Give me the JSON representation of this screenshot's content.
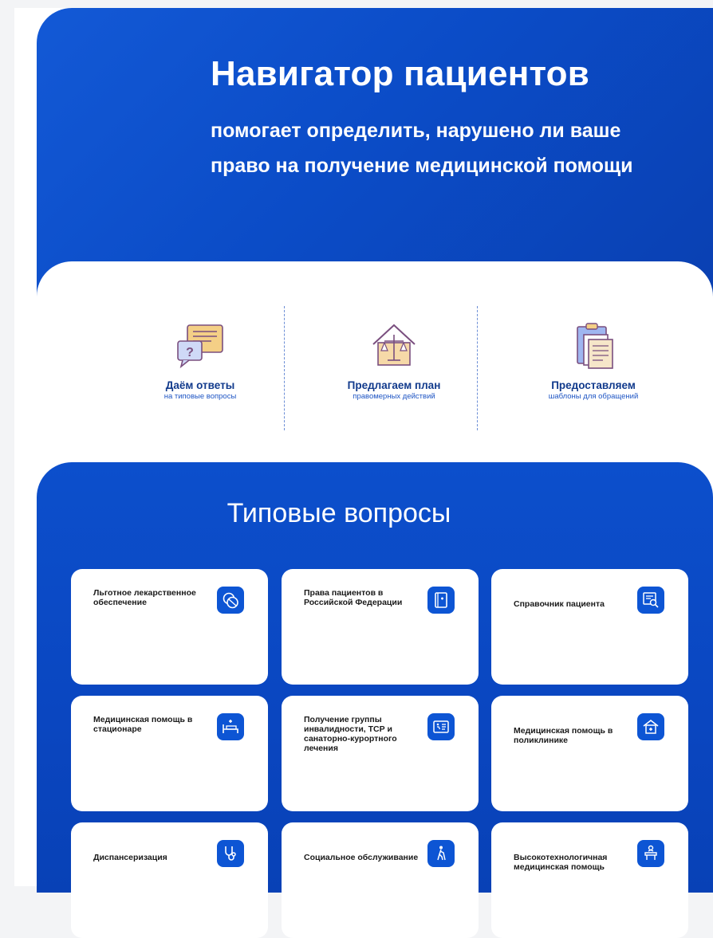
{
  "hero": {
    "title": "Навигатор пациентов",
    "subtitle": "помогает определить, нарушено ли ваше право на получение медицинской помощи"
  },
  "features": [
    {
      "title": "Даём ответы",
      "subtitle": "на типовые вопросы",
      "icon": "question-speech-icon"
    },
    {
      "title": "Предлагаем план",
      "subtitle": "правомерных действий",
      "icon": "scales-house-icon"
    },
    {
      "title": "Предоставляем",
      "subtitle": "шаблоны для обращений",
      "icon": "clipboard-documents-icon"
    }
  ],
  "questions": {
    "heading": "Типовые вопросы",
    "cards": [
      {
        "label": "Льготное лекарственное обеспечение",
        "icon": "pills-icon"
      },
      {
        "label": "Права пациентов в Российской Федерации",
        "icon": "rights-book-icon"
      },
      {
        "label": "Справочник пациента",
        "icon": "reference-search-icon"
      },
      {
        "label": "Медицинская помощь в стационаре",
        "icon": "hospital-bed-icon"
      },
      {
        "label": "Получение группы инвалидности, ТСР и санаторно-курортного лечения",
        "icon": "disability-document-icon"
      },
      {
        "label": "Медицинская помощь в поликлинике",
        "icon": "clinic-icon"
      },
      {
        "label": "Диспансеризация",
        "icon": "stethoscope-icon"
      },
      {
        "label": "Социальное обслуживание",
        "icon": "elderly-person-icon"
      },
      {
        "label": "Высокотехнологичная медицинская помощь",
        "icon": "high-tech-surgery-icon"
      }
    ]
  },
  "colors": {
    "primary_blue": "#0b4cc7",
    "feature_title": "#113a8c",
    "card_icon_bg": "#0d55d4"
  }
}
